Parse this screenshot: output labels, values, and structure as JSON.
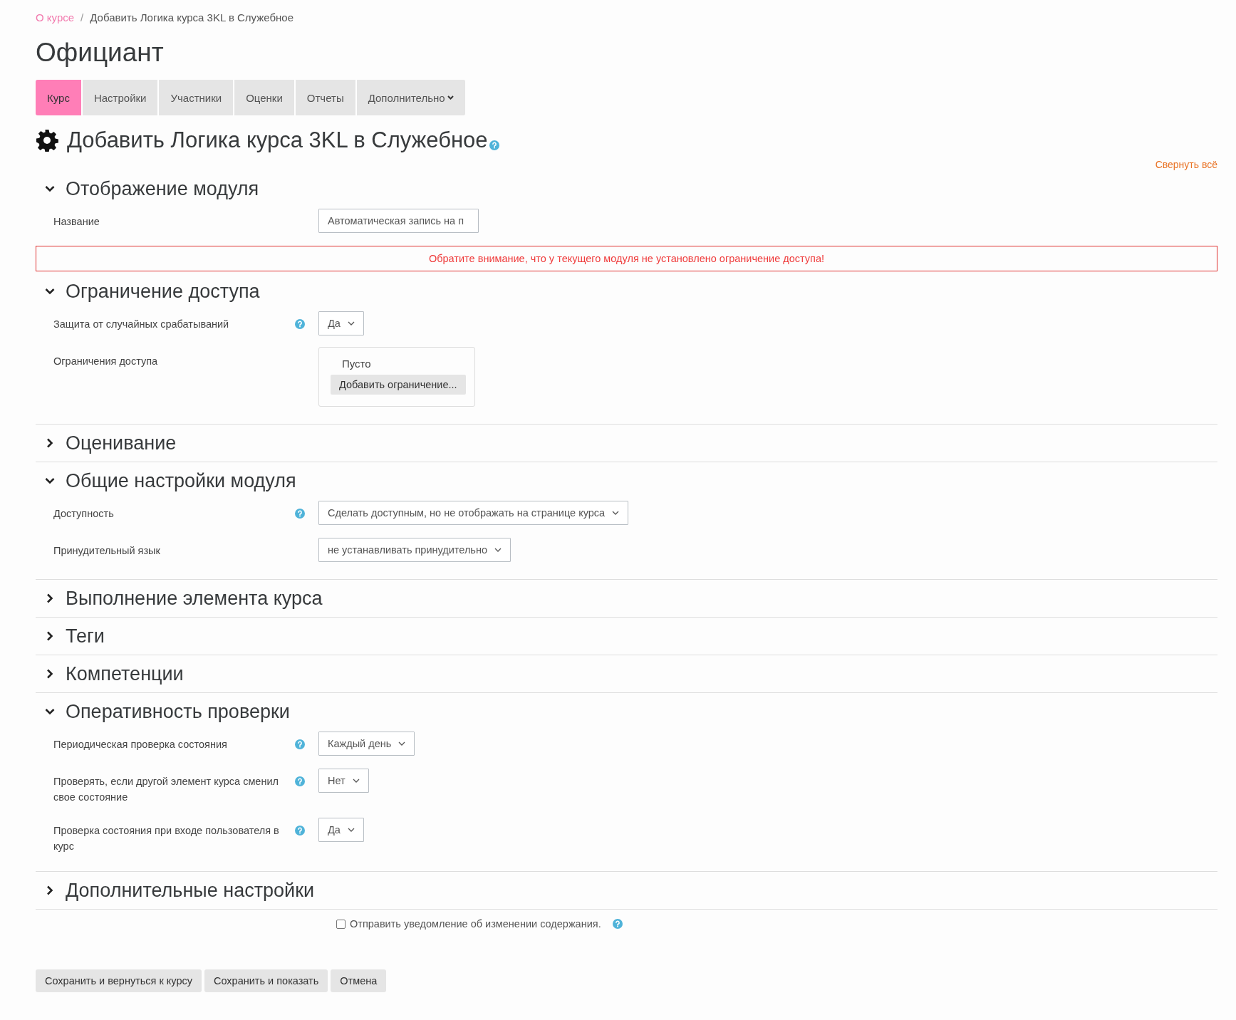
{
  "breadcrumb": [
    {
      "label": "О курсе",
      "link": true
    },
    {
      "label": "Добавить Логика курса 3KL в Служебное",
      "link": false
    }
  ],
  "breadcrumb_separator": "/",
  "title": "Официант",
  "tabs": [
    {
      "label": "Курс",
      "selected": true,
      "dropdown": false
    },
    {
      "label": "Настройки",
      "selected": false,
      "dropdown": false
    },
    {
      "label": "Участники",
      "selected": false,
      "dropdown": false
    },
    {
      "label": "Оценки",
      "selected": false,
      "dropdown": false
    },
    {
      "label": "Отчеты",
      "selected": false,
      "dropdown": false
    },
    {
      "label": "Дополнительно",
      "selected": false,
      "dropdown": true
    }
  ],
  "heading": {
    "text": "Добавить Логика курса 3KL в Служебное",
    "help": true
  },
  "collapse_all": "Свернуть всё",
  "sections": [
    {
      "title": "Отображение модуля",
      "expanded": true,
      "fields": [
        {
          "kind": "text",
          "label": "Название",
          "value": "Автоматическая запись на п"
        }
      ],
      "alert": "Обратите внимание, что у текущего модуля не установлено ограничение доступа!"
    },
    {
      "title": "Ограничение доступа",
      "expanded": true,
      "fields": [
        {
          "kind": "select",
          "label": "Защита от случайных срабатываний",
          "help": true,
          "value": "Да"
        },
        {
          "kind": "restrictions",
          "label": "Ограничения доступа",
          "empty_text": "Пусто",
          "button": "Добавить ограничение..."
        }
      ]
    },
    {
      "title": "Оценивание",
      "expanded": false
    },
    {
      "title": "Общие настройки модуля",
      "expanded": true,
      "fields": [
        {
          "kind": "select",
          "label": "Доступность",
          "help": true,
          "value": "Сделать доступным, но не отображать на странице курса"
        },
        {
          "kind": "select",
          "label": "Принудительный язык",
          "value": "не устанавливать принудительно"
        }
      ]
    },
    {
      "title": "Выполнение элемента курса",
      "expanded": false
    },
    {
      "title": "Теги",
      "expanded": false
    },
    {
      "title": "Компетенции",
      "expanded": false
    },
    {
      "title": "Оперативность проверки",
      "expanded": true,
      "fields": [
        {
          "kind": "select",
          "label": "Периодическая проверка состояния",
          "help": true,
          "value": "Каждый день"
        },
        {
          "kind": "select",
          "label": "Проверять, если другой элемент курса сменил свое состояние",
          "help": true,
          "value": "Нет"
        },
        {
          "kind": "select",
          "label": "Проверка состояния при входе пользователя в курс",
          "help": true,
          "value": "Да"
        }
      ]
    },
    {
      "title": "Дополнительные настройки",
      "expanded": false
    }
  ],
  "notify": {
    "label": "Отправить уведомление об изменении содержания.",
    "checked": false,
    "help": true
  },
  "buttons": [
    "Сохранить и вернуться к курсу",
    "Сохранить и показать",
    "Отмена"
  ]
}
